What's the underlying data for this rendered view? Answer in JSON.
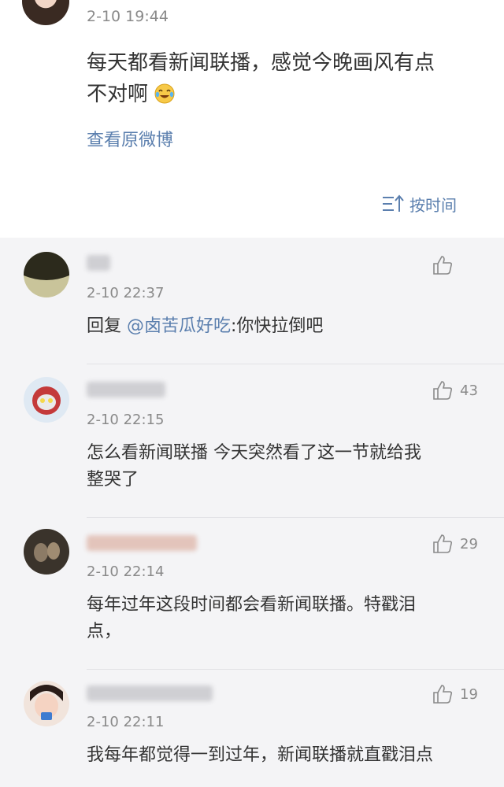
{
  "post": {
    "time": "2-10 19:44",
    "text_line1": "每天都看新闻联播，感觉今晚画风有点",
    "text_line2": "不对啊",
    "emoji": "laughing-crying-emoji",
    "view_original": "查看原微博",
    "sort_label": "按时间",
    "sort_icon": "sort-icon"
  },
  "comments": [
    {
      "time": "2-10 22:37",
      "reply_prefix": "回复 ",
      "mention": "@卤苦瓜好吃",
      "text": ":你快拉倒吧",
      "likes": "",
      "avatar_color": "#3f3f2a"
    },
    {
      "time": "2-10 22:15",
      "text_line1": "怎么看新闻联播 今天突然看了这一节就给我",
      "text_line2": "整哭了",
      "likes": "43",
      "avatar_color": "#6a8fb5"
    },
    {
      "time": "2-10 22:14",
      "text_line1": "每年过年这段时间都会看新闻联播。特戳泪",
      "text_line2": "点，",
      "likes": "29",
      "avatar_color": "#2e2a25"
    },
    {
      "time": "2-10 22:11",
      "text_line1": "我每年都觉得一到过年，新闻联播就直戳泪点",
      "likes": "19",
      "avatar_color": "#e8c7b8"
    }
  ],
  "colors": {
    "link": "#5b7fae",
    "muted": "#8a8a8a",
    "text": "#333333",
    "background": "#f4f4f6"
  }
}
